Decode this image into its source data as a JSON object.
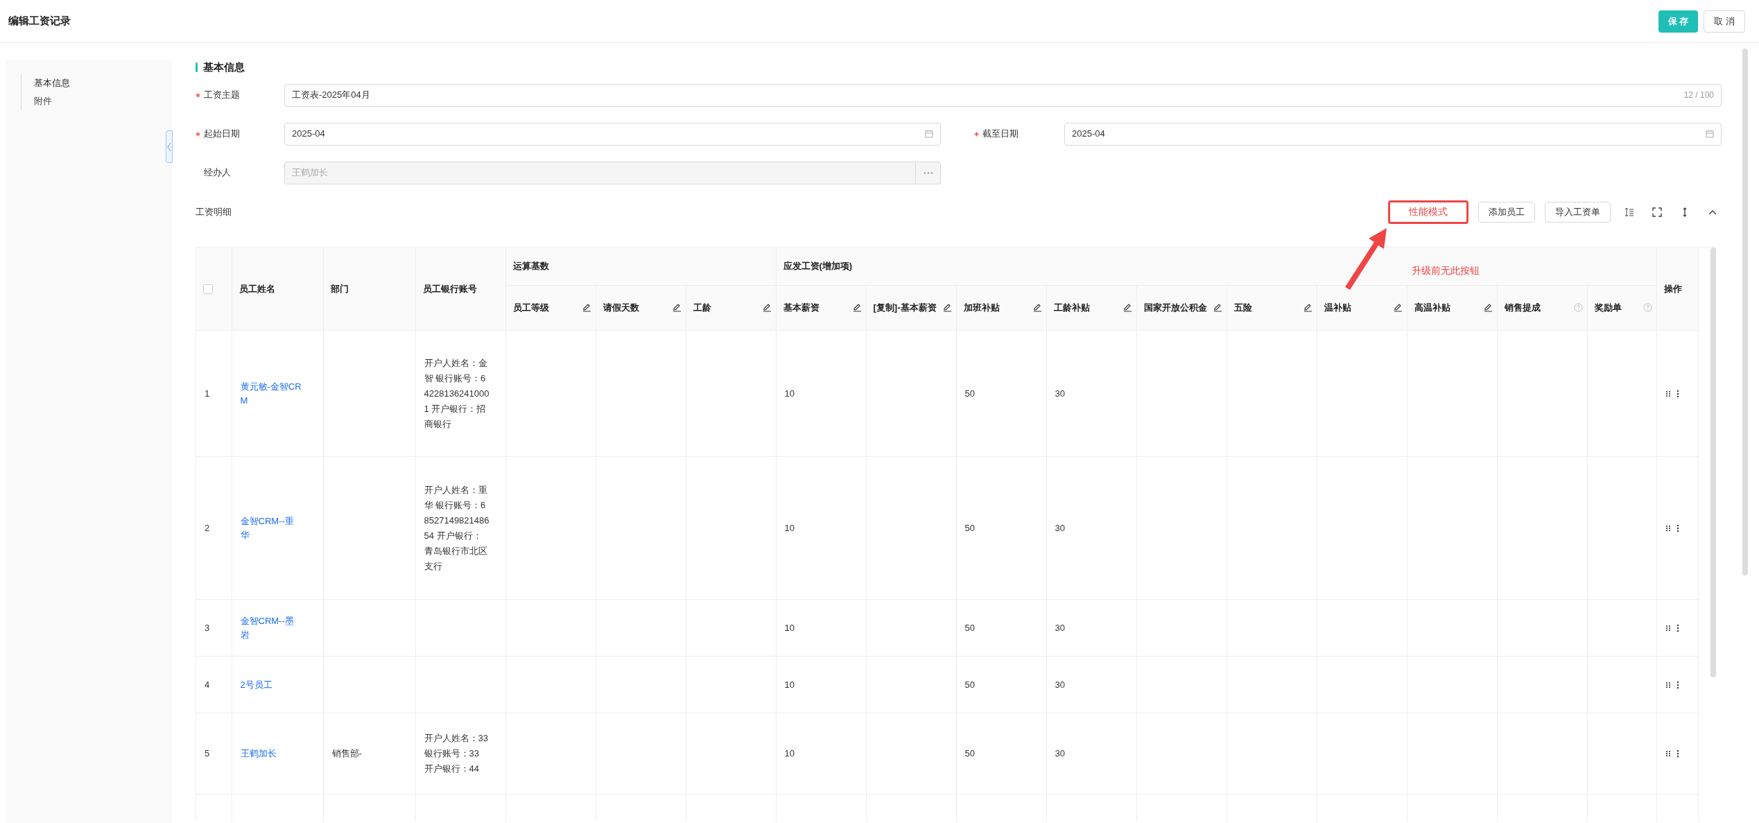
{
  "header": {
    "title": "编辑工资记录",
    "buttons": [
      {
        "label": "保 存",
        "kind": "primary"
      },
      {
        "label": "取 消",
        "kind": "default"
      }
    ]
  },
  "sidebar": {
    "items": [
      {
        "label": "基本信息",
        "selected": true
      },
      {
        "label": "附件",
        "selected": false
      }
    ]
  },
  "section": {
    "title": "基本信息"
  },
  "fields": [
    {
      "label": "工资主题",
      "required": true,
      "value": "工资表-2025年04月",
      "counter": "12 / 100",
      "kind": "text"
    },
    {
      "label": "起始日期",
      "required": true,
      "value": "2025-04",
      "kind": "date"
    },
    {
      "label": "截至日期",
      "required": true,
      "value": "2025-04",
      "kind": "date"
    },
    {
      "label": "经办人",
      "required": false,
      "value": "王鹤加长",
      "kind": "picker",
      "disabled": true
    }
  ],
  "details": {
    "title": "工资明细",
    "buttons": [
      {
        "label": "性能模式",
        "highlighted": true
      },
      {
        "label": "添加员工",
        "highlighted": false
      },
      {
        "label": "导入工资单",
        "highlighted": false
      }
    ]
  },
  "annotation": {
    "text": "升级前无此按钮"
  },
  "table": {
    "select_all": {
      "checked": false
    },
    "fixed_columns": [
      "员工姓名",
      "部门",
      "员工银行账号"
    ],
    "groups": [
      {
        "label": "运算基数",
        "columns": [
          {
            "label": "员工等级",
            "kind": "edit"
          },
          {
            "label": "请假天数",
            "kind": "edit"
          },
          {
            "label": "工龄",
            "kind": "edit"
          }
        ]
      },
      {
        "label": "应发工资(增加项)",
        "columns": [
          {
            "label": "基本薪资",
            "kind": "edit"
          },
          {
            "label": "[复制]-基本薪资",
            "kind": "edit"
          },
          {
            "label": "加班补贴",
            "kind": "edit"
          },
          {
            "label": "工龄补贴",
            "kind": "edit"
          },
          {
            "label": "国家开放公积金",
            "kind": "edit"
          },
          {
            "label": "五险",
            "kind": "edit"
          },
          {
            "label": "温补贴",
            "kind": "edit"
          },
          {
            "label": "高温补贴",
            "kind": "edit"
          },
          {
            "label": "销售提成",
            "kind": "help"
          },
          {
            "label": "奖励单",
            "kind": "help"
          }
        ]
      }
    ],
    "action_column": "操作",
    "rows": [
      {
        "index": "1",
        "name": "黄元敏-金智CRM",
        "bank": "开户人姓名：金智 银行账号：642281362410001 开户银行：招商银行",
        "basic_salary": "10",
        "overtime_allowance": "50",
        "seniority_allowance": "30"
      },
      {
        "index": "2",
        "name": "金智CRM--重华",
        "bank": "开户人姓名：重华 银行账号：6852714982148654 开户银行：青岛银行市北区支行",
        "basic_salary": "10",
        "overtime_allowance": "50",
        "seniority_allowance": "30"
      },
      {
        "index": "3",
        "name": "金智CRM--墨岩",
        "basic_salary": "10",
        "overtime_allowance": "50",
        "seniority_allowance": "30"
      },
      {
        "index": "4",
        "name": "2号员工",
        "basic_salary": "10",
        "overtime_allowance": "50",
        "seniority_allowance": "30"
      },
      {
        "index": "5",
        "name": "王鹤加长",
        "dept": "销售部-",
        "bank": "开户人姓名：33 银行账号：33 开户银行：44",
        "basic_salary": "10",
        "overtime_allowance": "50",
        "seniority_allowance": "30"
      }
    ]
  }
}
